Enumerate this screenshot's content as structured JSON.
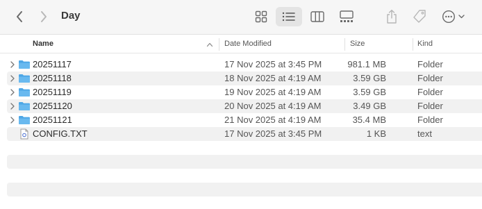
{
  "window": {
    "title": "Day"
  },
  "columns": {
    "name": "Name",
    "date": "Date Modified",
    "size": "Size",
    "kind": "Kind"
  },
  "rows": [
    {
      "name": "20251117",
      "date": "17 Nov 2025 at 3:45 PM",
      "size": "981.1 MB",
      "kind": "Folder",
      "type": "folder"
    },
    {
      "name": "20251118",
      "date": "18 Nov 2025 at 4:19 AM",
      "size": "3.59 GB",
      "kind": "Folder",
      "type": "folder"
    },
    {
      "name": "20251119",
      "date": "19 Nov 2025 at 4:19 AM",
      "size": "3.59 GB",
      "kind": "Folder",
      "type": "folder"
    },
    {
      "name": "20251120",
      "date": "20 Nov 2025 at 4:19 AM",
      "size": "3.49 GB",
      "kind": "Folder",
      "type": "folder"
    },
    {
      "name": "20251121",
      "date": "21 Nov 2025 at 4:19 AM",
      "size": "35.4 MB",
      "kind": "Folder",
      "type": "folder"
    },
    {
      "name": "CONFIG.TXT",
      "date": "17 Nov 2025 at 3:45 PM",
      "size": "1 KB",
      "kind": "text",
      "type": "text-file"
    }
  ],
  "icons": {
    "back": "chevron-left-icon",
    "forward": "chevron-right-icon",
    "icon_view": "grid-icon",
    "list_view": "list-icon",
    "column_view": "columns-icon",
    "gallery_view": "gallery-icon",
    "share": "share-icon",
    "tag": "tag-icon",
    "more": "ellipsis-circle-icon",
    "folder": "folder-icon",
    "text_file": "text-file-icon"
  },
  "colors": {
    "folder": "#5aaee8",
    "selected_view_bg": "#e4e4e4",
    "stripe": "#f1f1f1",
    "toolbar_bg": "#f6f6f6"
  }
}
